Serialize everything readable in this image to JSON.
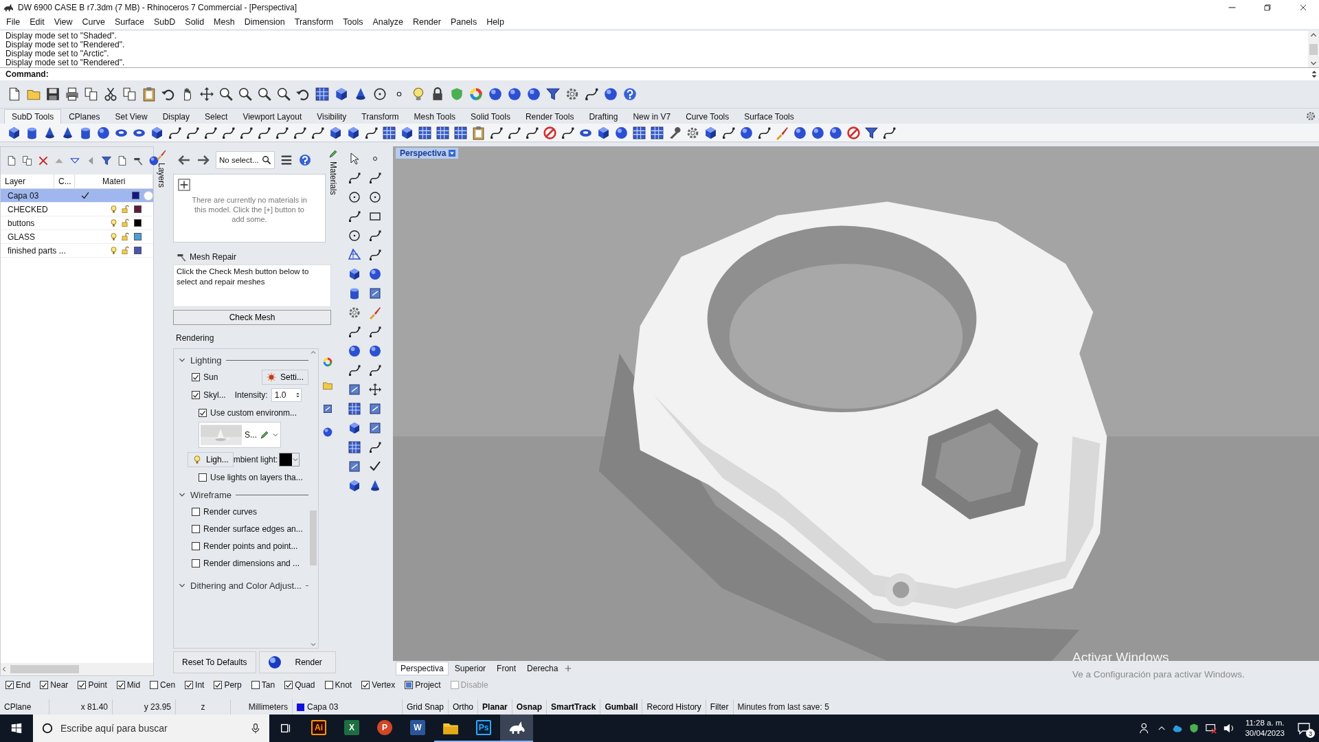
{
  "window": {
    "title": "DW 6900 CASE B r7.3dm (7 MB) - Rhinoceros 7 Commercial - [Perspectiva]"
  },
  "menu": [
    "File",
    "Edit",
    "View",
    "Curve",
    "Surface",
    "SubD",
    "Solid",
    "Mesh",
    "Dimension",
    "Transform",
    "Tools",
    "Analyze",
    "Render",
    "Panels",
    "Help"
  ],
  "command_history": [
    "Display mode set to \"Shaded\".",
    "Display mode set to \"Rendered\".",
    "Display mode set to \"Arctic\".",
    "Display mode set to \"Rendered\"."
  ],
  "command": {
    "prompt": "Command:"
  },
  "toolbar_tabs": [
    {
      "label": "SubD Tools",
      "selected": true
    },
    {
      "label": "CPlanes",
      "selected": false
    },
    {
      "label": "Set View",
      "selected": false
    },
    {
      "label": "Display",
      "selected": false
    },
    {
      "label": "Select",
      "selected": false
    },
    {
      "label": "Viewport Layout",
      "selected": false
    },
    {
      "label": "Visibility",
      "selected": false
    },
    {
      "label": "Transform",
      "selected": false
    },
    {
      "label": "Mesh Tools",
      "selected": false
    },
    {
      "label": "Solid Tools",
      "selected": false
    },
    {
      "label": "Render Tools",
      "selected": false
    },
    {
      "label": "Drafting",
      "selected": false
    },
    {
      "label": "New in V7",
      "selected": false
    },
    {
      "label": "Curve Tools",
      "selected": false
    },
    {
      "label": "Surface Tools",
      "selected": false
    }
  ],
  "layers_panel": {
    "tab": "Layers",
    "columns": [
      "Layer",
      "C...",
      "Materi"
    ],
    "layers": [
      {
        "name": "Capa 03",
        "selected": true,
        "current": true,
        "color": "#14148c"
      },
      {
        "name": "CHECKED",
        "selected": false,
        "current": false,
        "color": "#5a1f3a"
      },
      {
        "name": "buttons",
        "selected": false,
        "current": false,
        "color": "#000000"
      },
      {
        "name": "GLASS",
        "selected": false,
        "current": false,
        "color": "#4a9fd8"
      },
      {
        "name": "finished parts ...",
        "selected": false,
        "current": false,
        "color": "#4a55b0"
      }
    ]
  },
  "materials_panel": {
    "tab": "Materials",
    "search": "No select...",
    "message": "There are currently no materials in this model. Click the [+] button to add some."
  },
  "mesh_repair": {
    "title": "Mesh Repair",
    "instructions": "Click the Check Mesh button below to select and repair meshes",
    "button": "Check Mesh"
  },
  "rendering": {
    "title": "Rendering",
    "lighting": {
      "title": "Lighting",
      "expanded": true,
      "sun": {
        "label": "Sun",
        "checked": true,
        "button": "Setti..."
      },
      "sky": {
        "label": "Skyl...",
        "checked": true,
        "intensity_label": "Intensity:",
        "intensity": "1.0"
      },
      "custom_environment": {
        "label": "Use custom environm...",
        "checked": true,
        "environment": "S..."
      },
      "light_button": "Ligh...",
      "ambient": {
        "label": "mbient light:",
        "color": "#000000"
      },
      "layer_lights": {
        "label": "Use lights on layers tha...",
        "checked": false
      }
    },
    "wireframe": {
      "title": "Wireframe",
      "expanded": true,
      "options": [
        {
          "label": "Render curves",
          "checked": false
        },
        {
          "label": "Render surface edges an...",
          "checked": false
        },
        {
          "label": "Render points and point...",
          "checked": false
        },
        {
          "label": "Render dimensions and ...",
          "checked": false
        }
      ]
    },
    "dithering": {
      "title": "Dithering and Color Adjust...",
      "expanded": true
    },
    "buttons": [
      "Reset To Defaults",
      "Render"
    ]
  },
  "viewport": {
    "label": "Perspectiva",
    "tabs": [
      {
        "label": "Perspectiva",
        "selected": true
      },
      {
        "label": "Superior",
        "selected": false
      },
      {
        "label": "Front",
        "selected": false
      },
      {
        "label": "Derecha",
        "selected": false
      }
    ]
  },
  "osnaps": [
    {
      "label": "End",
      "kind": "check",
      "checked": true,
      "disabled": false
    },
    {
      "label": "Near",
      "kind": "check",
      "checked": true,
      "disabled": false
    },
    {
      "label": "Point",
      "kind": "check",
      "checked": true,
      "disabled": false
    },
    {
      "label": "Mid",
      "kind": "check",
      "checked": true,
      "disabled": false
    },
    {
      "label": "Cen",
      "kind": "check",
      "checked": false,
      "disabled": false
    },
    {
      "label": "Int",
      "kind": "check",
      "checked": true,
      "disabled": false
    },
    {
      "label": "Perp",
      "kind": "check",
      "checked": true,
      "disabled": false
    },
    {
      "label": "Tan",
      "kind": "check",
      "checked": false,
      "disabled": false
    },
    {
      "label": "Quad",
      "kind": "check",
      "checked": true,
      "disabled": false
    },
    {
      "label": "Knot",
      "kind": "check",
      "checked": false,
      "disabled": false
    },
    {
      "label": "Vertex",
      "kind": "check",
      "checked": true,
      "disabled": false
    },
    {
      "label": "Project",
      "kind": "toggle",
      "checked": true,
      "disabled": false
    },
    {
      "label": "Disable",
      "kind": "check",
      "checked": false,
      "disabled": true
    }
  ],
  "status_bar": {
    "cplane": "CPlane",
    "x": "x 81.40",
    "y": "y 23.95",
    "z": "z",
    "units": "Millimeters",
    "layer": {
      "name": "Capa 03",
      "color": "#1010e0"
    },
    "toggles": [
      {
        "label": "Grid Snap",
        "on": false
      },
      {
        "label": "Ortho",
        "on": false
      },
      {
        "label": "Planar",
        "on": true
      },
      {
        "label": "Osnap",
        "on": true
      },
      {
        "label": "SmartTrack",
        "on": true
      },
      {
        "label": "Gumball",
        "on": true
      },
      {
        "label": "Record History",
        "on": false
      },
      {
        "label": "Filter",
        "on": false
      }
    ],
    "save_info": "Minutes from last save: 5"
  },
  "activation_notice": {
    "title": "Activar Windows",
    "message": "Ve a Configuración para activar Windows."
  },
  "taskbar": {
    "search_placeholder": "Escribe aquí para buscar",
    "apps": [
      {
        "kind": "illustrator",
        "label": "Ai",
        "running": false,
        "active": false
      },
      {
        "kind": "excel",
        "label": "X",
        "running": false,
        "active": false
      },
      {
        "kind": "powerpoint",
        "label": "P",
        "running": false,
        "active": false
      },
      {
        "kind": "word",
        "label": "W",
        "running": false,
        "active": false
      },
      {
        "kind": "explorer",
        "running": true,
        "active": false
      },
      {
        "kind": "photoshop",
        "label": "Ps",
        "running": true,
        "active": false
      },
      {
        "kind": "rhino",
        "running": true,
        "active": true
      }
    ],
    "time": "11:28 a. m.",
    "date": "30/04/2023",
    "notifications": "3"
  }
}
